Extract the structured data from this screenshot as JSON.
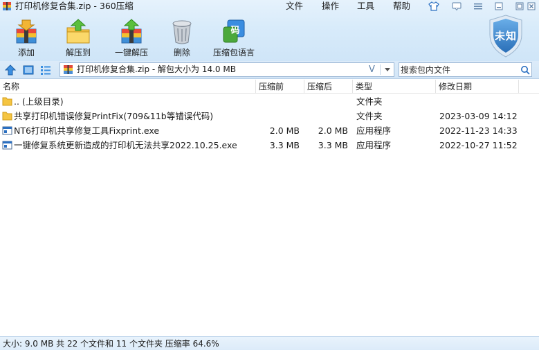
{
  "window": {
    "title": "打印机修复合集.zip - 360压缩"
  },
  "menu": {
    "items": [
      "文件",
      "操作",
      "工具",
      "帮助"
    ]
  },
  "toolbar": {
    "add": "添加",
    "extract_to": "解压到",
    "one_click_extract": "一键解压",
    "delete": "删除",
    "compress_language": "压缩包语言",
    "language_icon_char": "码"
  },
  "badge": {
    "text": "未知"
  },
  "address": {
    "path": "打印机修复合集.zip - 解包大小为 14.0 MB",
    "dropdown_glyph": "V"
  },
  "search": {
    "placeholder": "搜索包内文件"
  },
  "columns": {
    "name": "名称",
    "packed": "压缩前",
    "compressed": "压缩后",
    "type": "类型",
    "modified": "修改日期"
  },
  "files": [
    {
      "name": ".. (上级目录)",
      "packed": "",
      "compressed": "",
      "type": "文件夹",
      "modified": "",
      "icon": "folder-icon"
    },
    {
      "name": "共享打印机错误修复PrintFix(709&11b等错误代码)",
      "packed": "",
      "compressed": "",
      "type": "文件夹",
      "modified": "2023-03-09 14:12",
      "icon": "folder-icon"
    },
    {
      "name": "NT6打印机共享修复工具Fixprint.exe",
      "packed": "2.0 MB",
      "compressed": "2.0 MB",
      "type": "应用程序",
      "modified": "2022-11-23 14:33",
      "icon": "exe-icon"
    },
    {
      "name": "一键修复系统更新造成的打印机无法共享2022.10.25.exe",
      "packed": "3.3 MB",
      "compressed": "3.3 MB",
      "type": "应用程序",
      "modified": "2022-10-27 11:52",
      "icon": "exe-icon"
    }
  ],
  "status": {
    "text": "大小: 9.0 MB 共 22 个文件和 11 个文件夹 压缩率 64.6%"
  },
  "colors": {
    "accent": "#2a6fc1",
    "folder": "#f5c542",
    "badge": "#3b7fc4"
  }
}
